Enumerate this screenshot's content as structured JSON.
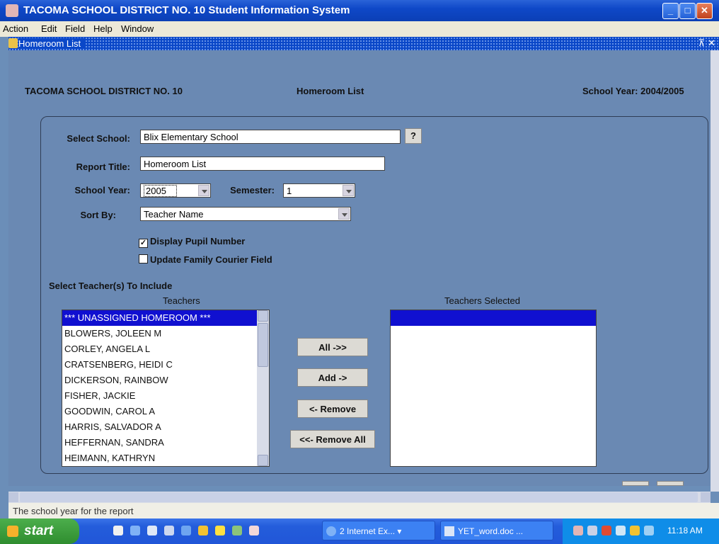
{
  "window": {
    "title": "TACOMA SCHOOL DISTRICT NO. 10 Student Information System"
  },
  "menu": [
    "Action",
    "Edit",
    "Field",
    "Help",
    "Window"
  ],
  "inner": {
    "title": "Homeroom List"
  },
  "header": {
    "district": "TACOMA SCHOOL DISTRICT NO. 10",
    "report": "Homeroom List",
    "year": "School Year: 2004/2005"
  },
  "form": {
    "school_label": "Select School:",
    "school_value": "Blix Elementary School",
    "lookup_btn": "?",
    "title_label": "Report Title:",
    "title_value": "Homeroom List",
    "year_label": "School Year:",
    "year_value": "2005",
    "semester_label": "Semester:",
    "semester_value": "1",
    "sort_label": "Sort By:",
    "sort_value": "Teacher Name",
    "chk_pupil": "Display Pupil Number",
    "chk_pupil_checked": true,
    "chk_courier": "Update Family Courier Field",
    "chk_courier_checked": false,
    "section": "Select Teacher(s) To Include"
  },
  "teachers": {
    "header": "Teachers",
    "items": [
      "*** UNASSIGNED HOMEROOM ***",
      "BLOWERS, JOLEEN M",
      "CORLEY, ANGELA L",
      "CRATSENBERG, HEIDI C",
      "DICKERSON, RAINBOW",
      "FISHER, JACKIE",
      "GOODWIN, CAROL A",
      "HARRIS, SALVADOR A",
      "HEFFERNAN, SANDRA",
      "HEIMANN, KATHRYN"
    ]
  },
  "selected": {
    "header": "Teachers Selected"
  },
  "buttons": {
    "all": "All ->>",
    "add": "Add ->",
    "remove": "<- Remove",
    "remove_all": "<<- Remove All"
  },
  "status": "The school year for the report",
  "taskbar": {
    "start": "start",
    "tasks": [
      "2 Internet Ex...",
      "YET_word.doc ..."
    ],
    "clock": "11:18 AM"
  }
}
